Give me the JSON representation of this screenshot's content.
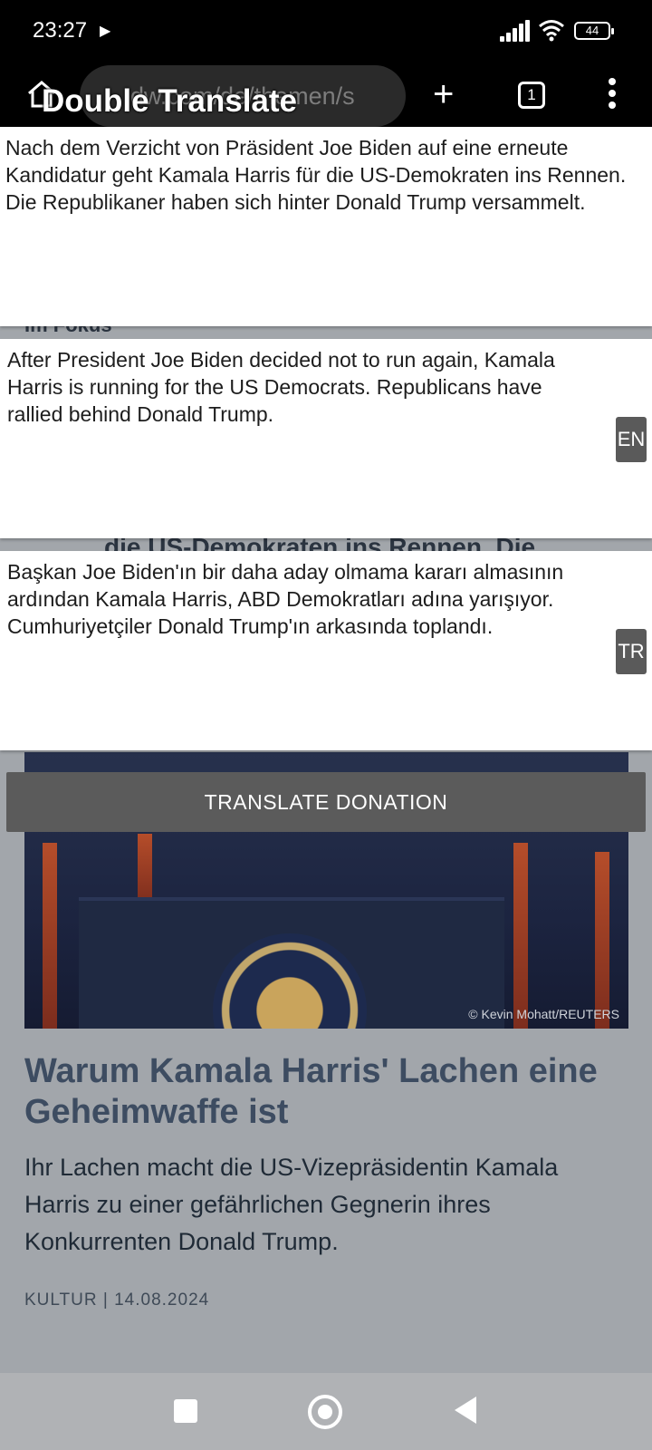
{
  "status_bar": {
    "time": "23:27",
    "battery": "44"
  },
  "browser": {
    "url": "dw.com/de/themen/s",
    "tab_count": "1"
  },
  "overlay": {
    "title": "Double Translate",
    "source_text": "Nach dem Verzicht von Präsident Joe Biden auf eine erneute Kandidatur geht Kamala Harris für die US-Demokraten ins Rennen. Die Republikaner haben sich hinter Donald Trump versammelt.",
    "translations": [
      {
        "lang": "EN",
        "text": "After President Joe Biden decided not to run again, Kamala Harris is running for the US Democrats. Republicans have rallied behind Donald Trump."
      },
      {
        "lang": "TR",
        "text": "Başkan Joe Biden'ın bir daha aday olmama kararı almasının ardından Kamala Harris, ABD Demokratları adına yarışıyor. Cumhuriyetçiler Donald Trump'ın arkasında toplandı."
      }
    ],
    "donation_button": "TRANSLATE DONATION"
  },
  "page": {
    "partial_heading_top": "Im Fokus",
    "partial_heading_mid": "die US-Demokraten ins Rennen. Die",
    "photo_credit": "© Kevin Mohatt/REUTERS",
    "article": {
      "headline": "Warum Kamala Harris' Lachen eine Geheimwaffe ist",
      "teaser": "Ihr Lachen macht die US-Vizepräsidentin Kamala Harris zu einer gefährlichen Gegnerin ihres Konkurrenten Donald Trump.",
      "category": "KULTUR",
      "date": "14.08.2024"
    }
  }
}
